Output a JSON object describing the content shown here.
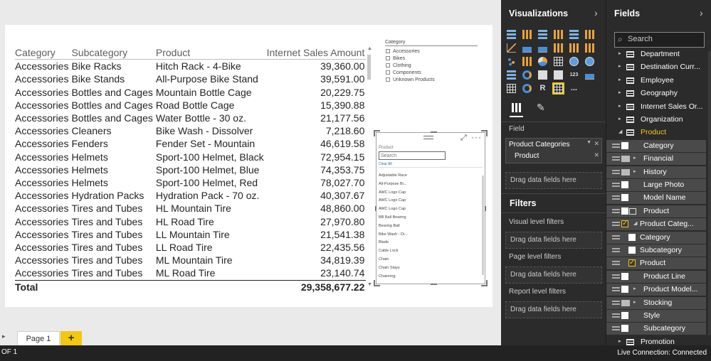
{
  "table": {
    "headers": [
      "Category",
      "Subcategory",
      "Product",
      "Internet Sales Amount"
    ],
    "rows": [
      [
        "Accessories",
        "Bike Racks",
        "Hitch Rack - 4-Bike",
        "39,360.00"
      ],
      [
        "Accessories",
        "Bike Stands",
        "All-Purpose Bike Stand",
        "39,591.00"
      ],
      [
        "Accessories",
        "Bottles and Cages",
        "Mountain Bottle Cage",
        "20,229.75"
      ],
      [
        "Accessories",
        "Bottles and Cages",
        "Road Bottle Cage",
        "15,390.88"
      ],
      [
        "Accessories",
        "Bottles and Cages",
        "Water Bottle - 30 oz.",
        "21,177.56"
      ],
      [
        "Accessories",
        "Cleaners",
        "Bike Wash - Dissolver",
        "7,218.60"
      ],
      [
        "Accessories",
        "Fenders",
        "Fender Set - Mountain",
        "46,619.58"
      ],
      [
        "Accessories",
        "Helmets",
        "Sport-100 Helmet, Black",
        "72,954.15"
      ],
      [
        "Accessories",
        "Helmets",
        "Sport-100 Helmet, Blue",
        "74,353.75"
      ],
      [
        "Accessories",
        "Helmets",
        "Sport-100 Helmet, Red",
        "78,027.70"
      ],
      [
        "Accessories",
        "Hydration Packs",
        "Hydration Pack - 70 oz.",
        "40,307.67"
      ],
      [
        "Accessories",
        "Tires and Tubes",
        "HL Mountain Tire",
        "48,860.00"
      ],
      [
        "Accessories",
        "Tires and Tubes",
        "HL Road Tire",
        "27,970.80"
      ],
      [
        "Accessories",
        "Tires and Tubes",
        "LL Mountain Tire",
        "21,541.38"
      ],
      [
        "Accessories",
        "Tires and Tubes",
        "LL Road Tire",
        "22,435.56"
      ],
      [
        "Accessories",
        "Tires and Tubes",
        "ML Mountain Tire",
        "34,819.39"
      ],
      [
        "Accessories",
        "Tires and Tubes",
        "ML Road Tire",
        "23,140.74"
      ]
    ],
    "total_label": "Total",
    "total_value": "29,358,677.22"
  },
  "category_slicer": {
    "title": "Category",
    "options": [
      "Accessories",
      "Bikes",
      "Clothing",
      "Components",
      "Unknown Products"
    ]
  },
  "product_slicer": {
    "title": "Product",
    "search_placeholder": "Search",
    "clear_all": "Clear All",
    "items": [
      "Adjustable Race",
      "All-Purpose Bi...",
      "AWC Logo Cap",
      "AWC Logo Cap",
      "AWC Logo Cap",
      "BB Ball Bearing",
      "Bearing Ball",
      "Bike Wash - Di...",
      "Blade",
      "Cable Lock",
      "Chain",
      "Chain Stays",
      "Chainring"
    ]
  },
  "page_tabs": {
    "tabs": [
      "Page 1"
    ],
    "add_label": "+"
  },
  "status_bar": {
    "page_indicator": "OF 1",
    "connection": "Live Connection: Connected"
  },
  "visualizations": {
    "title": "Visualizations",
    "field_section": "Field",
    "well_field": "Product Categories",
    "well_subfield": "Product",
    "drop_hint": "Drag data fields here",
    "filters_title": "Filters",
    "visual_filters": "Visual level filters",
    "page_filters": "Page level filters",
    "report_filters": "Report level filters",
    "icons": [
      "stacked-bar-icon",
      "clustered-column-icon",
      "stacked-bar-100-icon",
      "clustered-bar-icon",
      "stacked-column-100-icon",
      "column-chart-icon",
      "line-chart-icon",
      "area-chart-icon",
      "stacked-area-icon",
      "line-column-icon",
      "line-stacked-column-icon",
      "waterfall-icon",
      "scatter-chart-icon",
      "pie-chart-icon",
      "donut-chart-icon",
      "treemap-icon",
      "map-icon",
      "filled-map-icon",
      "funnel-icon",
      "gauge-icon",
      "card-icon",
      "multi-row-card-icon",
      "kpi-icon",
      "table-icon",
      "matrix-icon",
      "globe-icon",
      "r-script-icon",
      "slicer-icon",
      "more-visuals-icon"
    ],
    "r_label": "R",
    "kpi_label": "123",
    "more_label": "..."
  },
  "fields": {
    "title": "Fields",
    "search_placeholder": "Search",
    "items": [
      {
        "label": "Department",
        "type": "table"
      },
      {
        "label": "Destination Curr...",
        "type": "table"
      },
      {
        "label": "Employee",
        "type": "table"
      },
      {
        "label": "Geography",
        "type": "table"
      },
      {
        "label": "Internet Sales Or...",
        "type": "table"
      },
      {
        "label": "Organization",
        "type": "table"
      },
      {
        "label": "Product",
        "type": "table-open"
      },
      {
        "label": "Category",
        "type": "field"
      },
      {
        "label": "Financial",
        "type": "folder"
      },
      {
        "label": "History",
        "type": "folder"
      },
      {
        "label": "Large Photo",
        "type": "field"
      },
      {
        "label": "Model Name",
        "type": "field"
      },
      {
        "label": "Product",
        "type": "field-hier"
      },
      {
        "label": "Product Categ...",
        "type": "hier-open-checked"
      },
      {
        "label": "Category",
        "type": "level"
      },
      {
        "label": "Subcategory",
        "type": "level"
      },
      {
        "label": "Product",
        "type": "level-checked"
      },
      {
        "label": "Product Line",
        "type": "field"
      },
      {
        "label": "Product Model...",
        "type": "field-caret"
      },
      {
        "label": "Stocking",
        "type": "folder"
      },
      {
        "label": "Style",
        "type": "field"
      },
      {
        "label": "Subcategory",
        "type": "field"
      },
      {
        "label": "Promotion",
        "type": "table"
      }
    ]
  },
  "colors": {
    "accent": "#f2c811",
    "pane_bg": "#2b2b2b",
    "canvas_bg": "#eaeaea"
  }
}
